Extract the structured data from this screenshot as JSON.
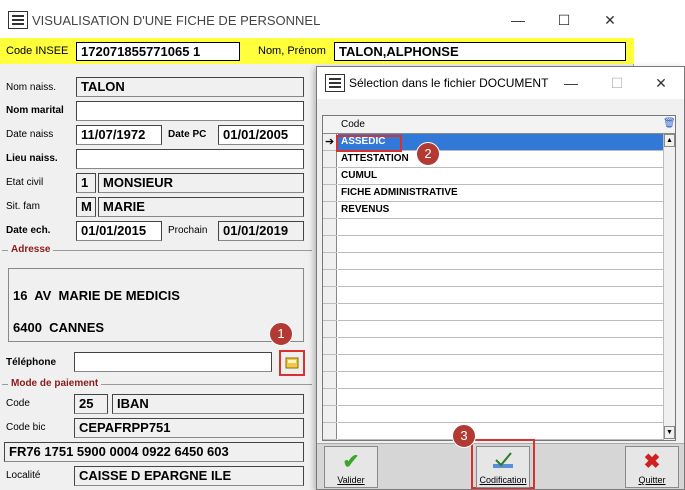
{
  "main": {
    "title": "VISUALISATION D'UNE FICHE DE PERSONNEL",
    "win_min": "—",
    "win_max": "☐",
    "win_close": "✕",
    "code_insee_label": "Code INSEE",
    "code_insee": "172071855771065 1",
    "nom_prenom_label": "Nom, Prénom",
    "nom_prenom": "TALON,ALPHONSE",
    "fields": {
      "nom_naiss_label": "Nom naiss.",
      "nom_naiss": "TALON",
      "nom_marital_label": "Nom marital",
      "nom_marital": "",
      "date_naiss_label": "Date naiss",
      "date_naiss": "11/07/1972",
      "date_pc_label": "Date PC",
      "date_pc": "01/01/2005",
      "lieu_naiss_label": "Lieu naiss.",
      "lieu_naiss": "",
      "etat_civil_label": "Etat civil",
      "etat_civil_code": "1",
      "etat_civil": "MONSIEUR",
      "sit_fam_label": "Sit. fam",
      "sit_fam_code": "M",
      "sit_fam": "MARIE",
      "date_ech_label": "Date ech.",
      "date_ech": "01/01/2015",
      "prochain_label": "Prochain",
      "prochain": "01/01/2019"
    },
    "adresse_title": "Adresse",
    "adresse_line1": "16  AV  MARIE DE MEDICIS",
    "adresse_line2": "6400  CANNES",
    "telephone_label": "Téléphone",
    "telephone": "",
    "paiement_title": "Mode de paiement",
    "code_label": "Code",
    "code_value": "25",
    "code_name": "IBAN",
    "code_bic_label": "Code bic",
    "code_bic": "CEPAFRPP751",
    "iban": "FR76 1751 5900 0004 0922 6450 603",
    "localite_label": "Localité",
    "localite": "CAISSE D EPARGNE ILE"
  },
  "dialog": {
    "title": "Sélection dans le fichier DOCUMENT",
    "win_min": "—",
    "win_max": "☐",
    "win_close": "✕",
    "column_header": "Code",
    "rows": [
      "ASSEDIC",
      "ATTESTATION",
      "CUMUL",
      "FICHE ADMINISTRATIVE",
      "REVENUS"
    ],
    "selected_row_marker": "➔",
    "buttons": {
      "valider": "Valider",
      "codification": "Codification",
      "quitter": "Quitter"
    }
  },
  "badges": [
    "1",
    "2",
    "3"
  ],
  "icons": {
    "valider": "checkmark-icon",
    "codification": "chart-check-icon",
    "quitter": "red-x-icon",
    "telephone": "phone-book-icon"
  }
}
